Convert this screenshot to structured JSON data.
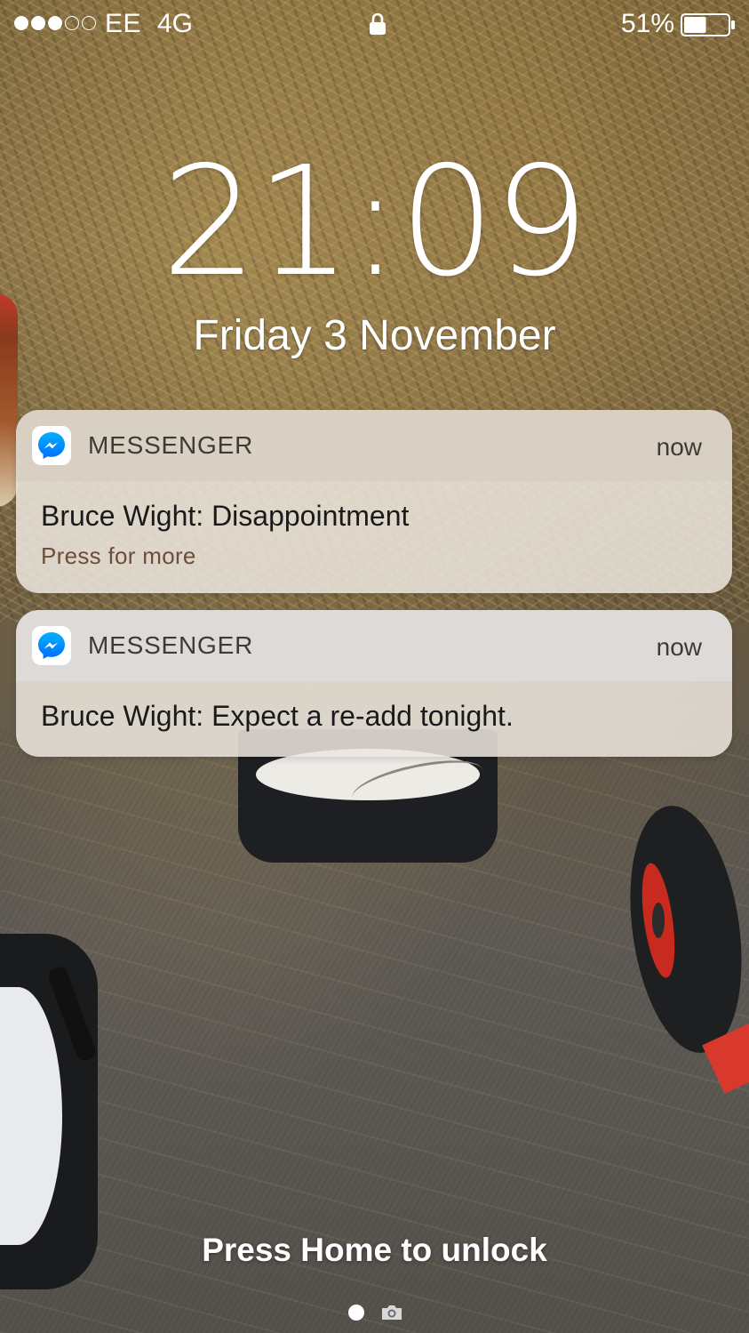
{
  "status_bar": {
    "signal_bars": {
      "filled": 3,
      "total": 5
    },
    "carrier": "EE",
    "network": "4G",
    "battery_percent_label": "51%",
    "battery_level": 0.51,
    "lock_icon": "lock-icon"
  },
  "lock_screen": {
    "time": "21:09",
    "date": "Friday 3 November"
  },
  "notifications": [
    {
      "app_icon": "messenger-icon",
      "app_name": "MESSENGER",
      "time": "now",
      "title": "Bruce Wight: Disappointment",
      "subtitle": "Press for more"
    },
    {
      "app_icon": "messenger-icon",
      "app_name": "MESSENGER",
      "time": "now",
      "title": "Bruce Wight: Expect a re-add tonight."
    }
  ],
  "bottom": {
    "unlock_hint": "Press Home to unlock",
    "page_dot_icon": "page-dot-icon",
    "camera_icon": "camera-icon"
  },
  "colors": {
    "messenger_blue": "#0084ff",
    "notification_bg": "#ece6de"
  }
}
